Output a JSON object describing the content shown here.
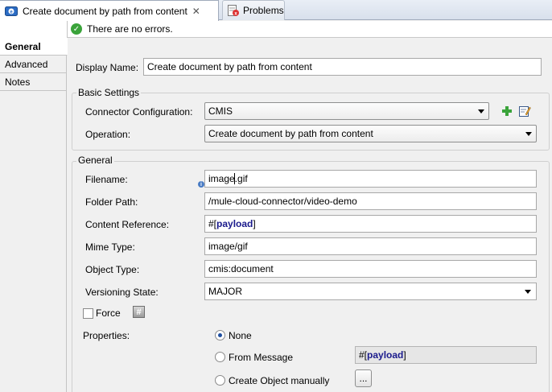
{
  "tabs": [
    {
      "label": "Create document by path from content",
      "icon": "mule-connector-icon",
      "active": true
    },
    {
      "label": "Problems",
      "icon": "problems-icon",
      "active": false
    }
  ],
  "status": {
    "text": "There are no errors.",
    "icon": "check-circle-icon"
  },
  "nav": {
    "items": [
      "General",
      "Advanced",
      "Notes"
    ],
    "selected": "General"
  },
  "display_name": {
    "label": "Display Name:",
    "value": "Create document by path from content"
  },
  "basic_settings": {
    "title": "Basic Settings",
    "connector_label": "Connector Configuration:",
    "connector_value": "CMIS",
    "operation_label": "Operation:",
    "operation_value": "Create document by path from content"
  },
  "general": {
    "title": "General",
    "filename_label": "Filename:",
    "filename_value": "image.gif",
    "folder_label": "Folder Path:",
    "folder_value": "/mule-cloud-connector/video-demo",
    "content_label": "Content Reference:",
    "content_open": "#[",
    "content_word": "payload",
    "content_close": "]",
    "mime_label": "Mime Type:",
    "mime_value": "image/gif",
    "objtype_label": "Object Type:",
    "objtype_value": "cmis:document",
    "versioning_label": "Versioning State:",
    "versioning_value": "MAJOR",
    "force_label": "Force",
    "force_checked": false,
    "hash_symbol": "#",
    "properties_label": "Properties:",
    "radio_none": "None",
    "radio_from_message": "From Message",
    "radio_manual": "Create Object manually",
    "radio_selected": "None",
    "from_message_open": "#[",
    "from_message_word": "payload",
    "from_message_close": "]",
    "manual_button": "..."
  },
  "colors": {
    "accent": "#1f4fa0",
    "ok": "#3aa33a",
    "expression": "#1a1a8c"
  }
}
